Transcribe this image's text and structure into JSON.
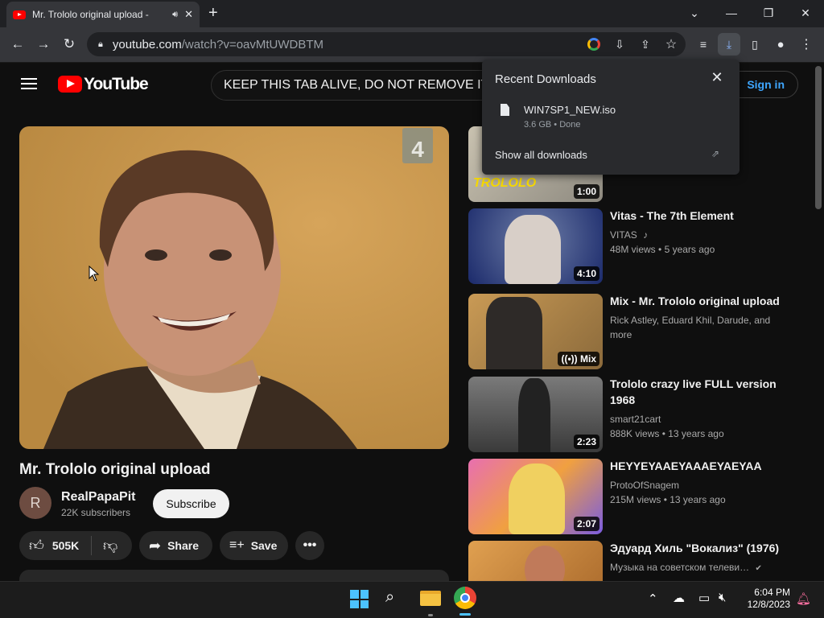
{
  "browser": {
    "tab_title": "Mr. Trololo original upload -",
    "url_host": "youtube.com",
    "url_path": "/watch?v=oavMtUWDBTM"
  },
  "youtube": {
    "logo_text": "YouTube",
    "search_value": "KEEP THIS TAB ALIVE,  DO NOT REMOVE IT.",
    "signin_label": "Sign in"
  },
  "video": {
    "title": "Mr. Trololo original upload",
    "channel_initial": "R",
    "channel_name": "RealPapaPit",
    "subscribers": "22K subscribers",
    "subscribe_label": "Subscribe",
    "likes": "505K",
    "share_label": "Share",
    "save_label": "Save",
    "channel_badge": "4"
  },
  "related": [
    {
      "title": "",
      "channel": "",
      "meta": "",
      "duration": "1:00",
      "thumb_text": "TROLOLO"
    },
    {
      "title": "Vitas - The 7th Element",
      "channel": "VITAS",
      "views": "48M views",
      "age": "5 years ago",
      "duration": "4:10"
    },
    {
      "title": "Mix - Mr. Trololo original upload",
      "channel": "Rick Astley, Eduard Khil, Darude, and more",
      "duration": "Mix"
    },
    {
      "title": "Trololo crazy live FULL version 1968",
      "channel": "smart21cart",
      "views": "888K views",
      "age": "13 years ago",
      "duration": "2:23"
    },
    {
      "title": "HEYYEYAAEYAAAEYAEYAA",
      "channel": "ProtoOfSnagem",
      "views": "215M views",
      "age": "13 years ago",
      "duration": "2:07"
    },
    {
      "title": "Эдуард Хиль \"Вокализ\" (1976)",
      "channel": "Музыка на советском телеви…"
    }
  ],
  "downloads": {
    "header": "Recent Downloads",
    "file_name": "WIN7SP1_NEW.iso",
    "file_status": "3.6 GB • Done",
    "show_all": "Show all downloads"
  },
  "taskbar": {
    "time": "6:04 PM",
    "date": "12/8/2023"
  }
}
